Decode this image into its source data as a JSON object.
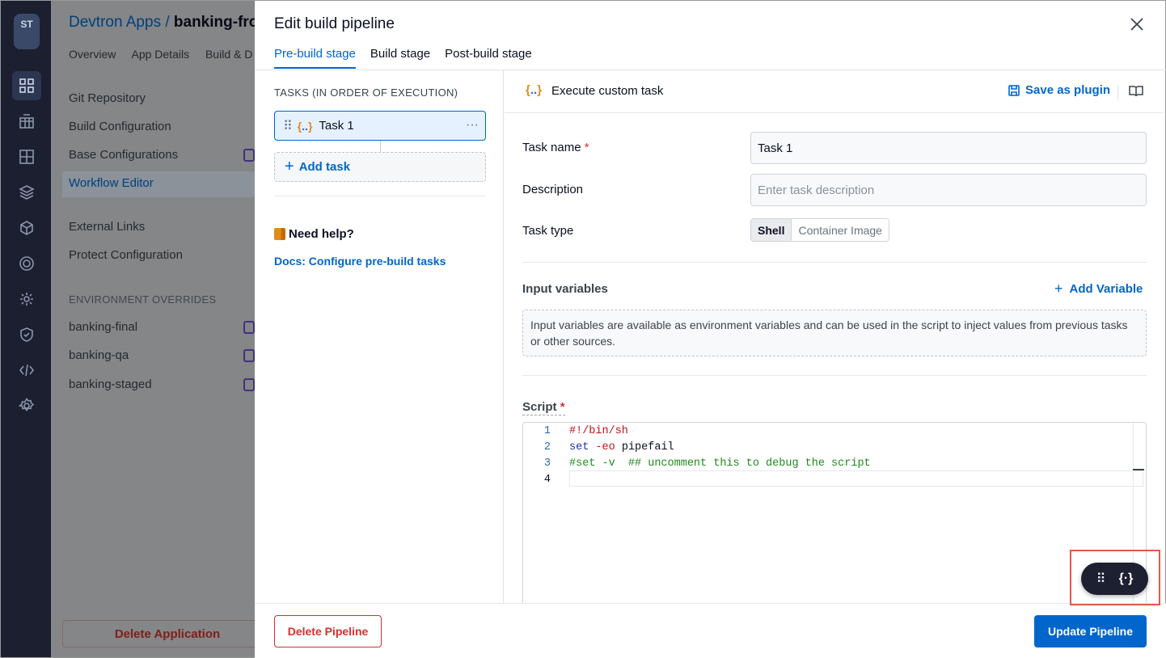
{
  "rail": {
    "logo_text": "ST",
    "icons": [
      "apps-grid-icon",
      "charts-icon",
      "resource-grid-icon",
      "stack-icon",
      "cube-icon",
      "security-target-icon",
      "bulk-edit-icon",
      "shield-icon",
      "code-icon",
      "settings-gear-icon"
    ]
  },
  "app": {
    "breadcrumb_parent": "Devtron Apps /",
    "breadcrumb_current": "banking-fro",
    "tabs": [
      "Overview",
      "App Details",
      "Build & D"
    ],
    "nav": [
      "Git Repository",
      "Build Configuration",
      "Base Configurations",
      "Workflow Editor",
      "External Links",
      "Protect Configuration"
    ],
    "env_overrides_title": "ENVIRONMENT OVERRIDES",
    "envs": [
      "banking-final",
      "banking-qa",
      "banking-staged"
    ],
    "delete_app": "Delete Application"
  },
  "modal": {
    "title": "Edit build pipeline",
    "stage_tabs": [
      "Pre-build stage",
      "Build stage",
      "Post-build stage"
    ],
    "active_tab": "Pre-build stage",
    "tasks_header": "TASKS (IN ORDER OF EXECUTION)",
    "task_name": "Task 1",
    "task_icon": "{..}",
    "add_task": "Add task",
    "need_help": "Need help?",
    "docs_link": "Docs: Configure pre-build tasks",
    "task_header": "Execute custom task",
    "save_as_plugin": "Save as plugin",
    "fields": {
      "task_name_label": "Task name",
      "task_name_value": "Task 1",
      "description_label": "Description",
      "description_placeholder": "Enter task description",
      "task_type_label": "Task type",
      "task_type_options": [
        "Shell",
        "Container Image"
      ],
      "task_type_selected": "Shell"
    },
    "input_variables": {
      "title": "Input variables",
      "add_label": "Add Variable",
      "info": "Input variables are available as environment variables and can be used in the script to inject values from previous tasks or other sources."
    },
    "script": {
      "label": "Script",
      "lines": [
        {
          "n": "1",
          "text": "#!/bin/sh"
        },
        {
          "n": "2",
          "text": "set -eo pipefail"
        },
        {
          "n": "3",
          "text": "#set -v  ## uncomment this to debug the script"
        },
        {
          "n": "4",
          "text": ""
        }
      ]
    },
    "delete_pipeline": "Delete Pipeline",
    "update_pipeline": "Update Pipeline"
  },
  "colors": {
    "accent": "#0066cc",
    "danger": "#d0312d",
    "highlight_box": "#e5584a"
  }
}
